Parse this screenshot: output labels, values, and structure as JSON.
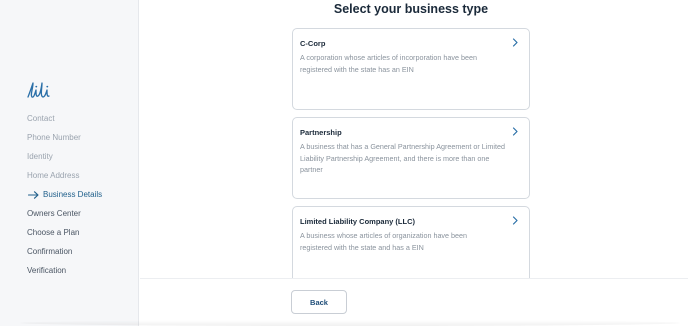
{
  "sidebar": {
    "logo_text": "lili",
    "nav": [
      {
        "label": "Contact",
        "state": "done"
      },
      {
        "label": "Phone Number",
        "state": "done"
      },
      {
        "label": "Identity",
        "state": "done"
      },
      {
        "label": "Home Address",
        "state": "done"
      },
      {
        "label": "Business Details",
        "state": "active"
      },
      {
        "label": "Owners Center",
        "state": "upcoming"
      },
      {
        "label": "Choose a Plan",
        "state": "upcoming"
      },
      {
        "label": "Confirmation",
        "state": "upcoming"
      },
      {
        "label": "Verification",
        "state": "upcoming"
      }
    ]
  },
  "main": {
    "title": "Select your business type",
    "options": [
      {
        "title": "C-Corp",
        "description": "A corporation whose articles of incorporation have been registered with the state has an EIN"
      },
      {
        "title": "Partnership",
        "description": "A business that has a General Partnership Agreement or Limited Liability Partnership Agreement, and there is more than one partner"
      },
      {
        "title": "Limited Liability Company (LLC)",
        "description": "A business whose articles of organization have been registered with the state and has a EIN"
      }
    ],
    "back_label": "Back"
  },
  "colors": {
    "brand": "#1f5f8b",
    "sidebar_bg": "#f6f7f9",
    "card_border": "#d4d9df",
    "muted_text": "#8a939d"
  }
}
